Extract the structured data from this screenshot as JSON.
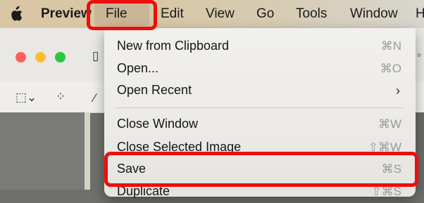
{
  "menubar": {
    "app_name": "Preview",
    "items": [
      "File",
      "Edit",
      "View",
      "Go",
      "Tools",
      "Window",
      "H"
    ]
  },
  "menu": {
    "items": [
      {
        "label": "New from Clipboard",
        "shortcut": "⌘N"
      },
      {
        "label": "Open...",
        "shortcut": "⌘O"
      },
      {
        "label": "Open Recent",
        "shortcut": ""
      },
      {
        "label": "Close Window",
        "shortcut": "⌘W"
      },
      {
        "label": "Close Selected Image",
        "shortcut": "⇧⌘W"
      },
      {
        "label": "Save",
        "shortcut": "⌘S"
      },
      {
        "label": "Duplicate",
        "shortcut": "⇧⌘S"
      }
    ]
  },
  "colors": {
    "highlight": "#ee0d0d",
    "traffic_red": "#fe5f57",
    "traffic_yellow": "#febc2e",
    "traffic_green": "#28c840"
  }
}
